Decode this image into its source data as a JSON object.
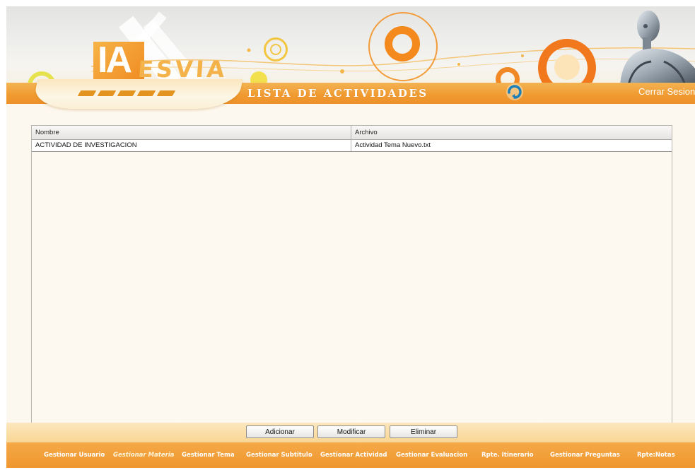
{
  "header": {
    "logo_ia": "IA",
    "logo_esvia": "ESVIA",
    "page_title": "LISTA DE ACTIVIDADES",
    "logout_label": "Cerrar Sesion",
    "refresh_icon": "refresh-icon"
  },
  "grid": {
    "columns": [
      "Nombre",
      "Archivo"
    ],
    "rows": [
      {
        "nombre": "ACTIVIDAD DE INVESTIGACION",
        "archivo": "Actividad Tema Nuevo.txt"
      }
    ]
  },
  "actions": {
    "add_label": "Adicionar",
    "edit_label": "Modificar",
    "delete_label": "Eliminar"
  },
  "nav": {
    "items": [
      {
        "label": "Gestionar Usuario"
      },
      {
        "label": "Gestionar Materia"
      },
      {
        "label": "Gestionar Tema"
      },
      {
        "label": "Gestionar Subtitulo"
      },
      {
        "label": "Gestionar Actividad"
      },
      {
        "label": "Gestionar Evaluacion"
      },
      {
        "label": "Rpte. Itinerario"
      },
      {
        "label": "Gestionar Preguntas"
      },
      {
        "label": "Rpte:Notas"
      }
    ],
    "active_index": 1
  },
  "colors": {
    "accent": "#ef972f",
    "accent_light": "#f3b352",
    "panel_bg": "#fdf9f0"
  }
}
